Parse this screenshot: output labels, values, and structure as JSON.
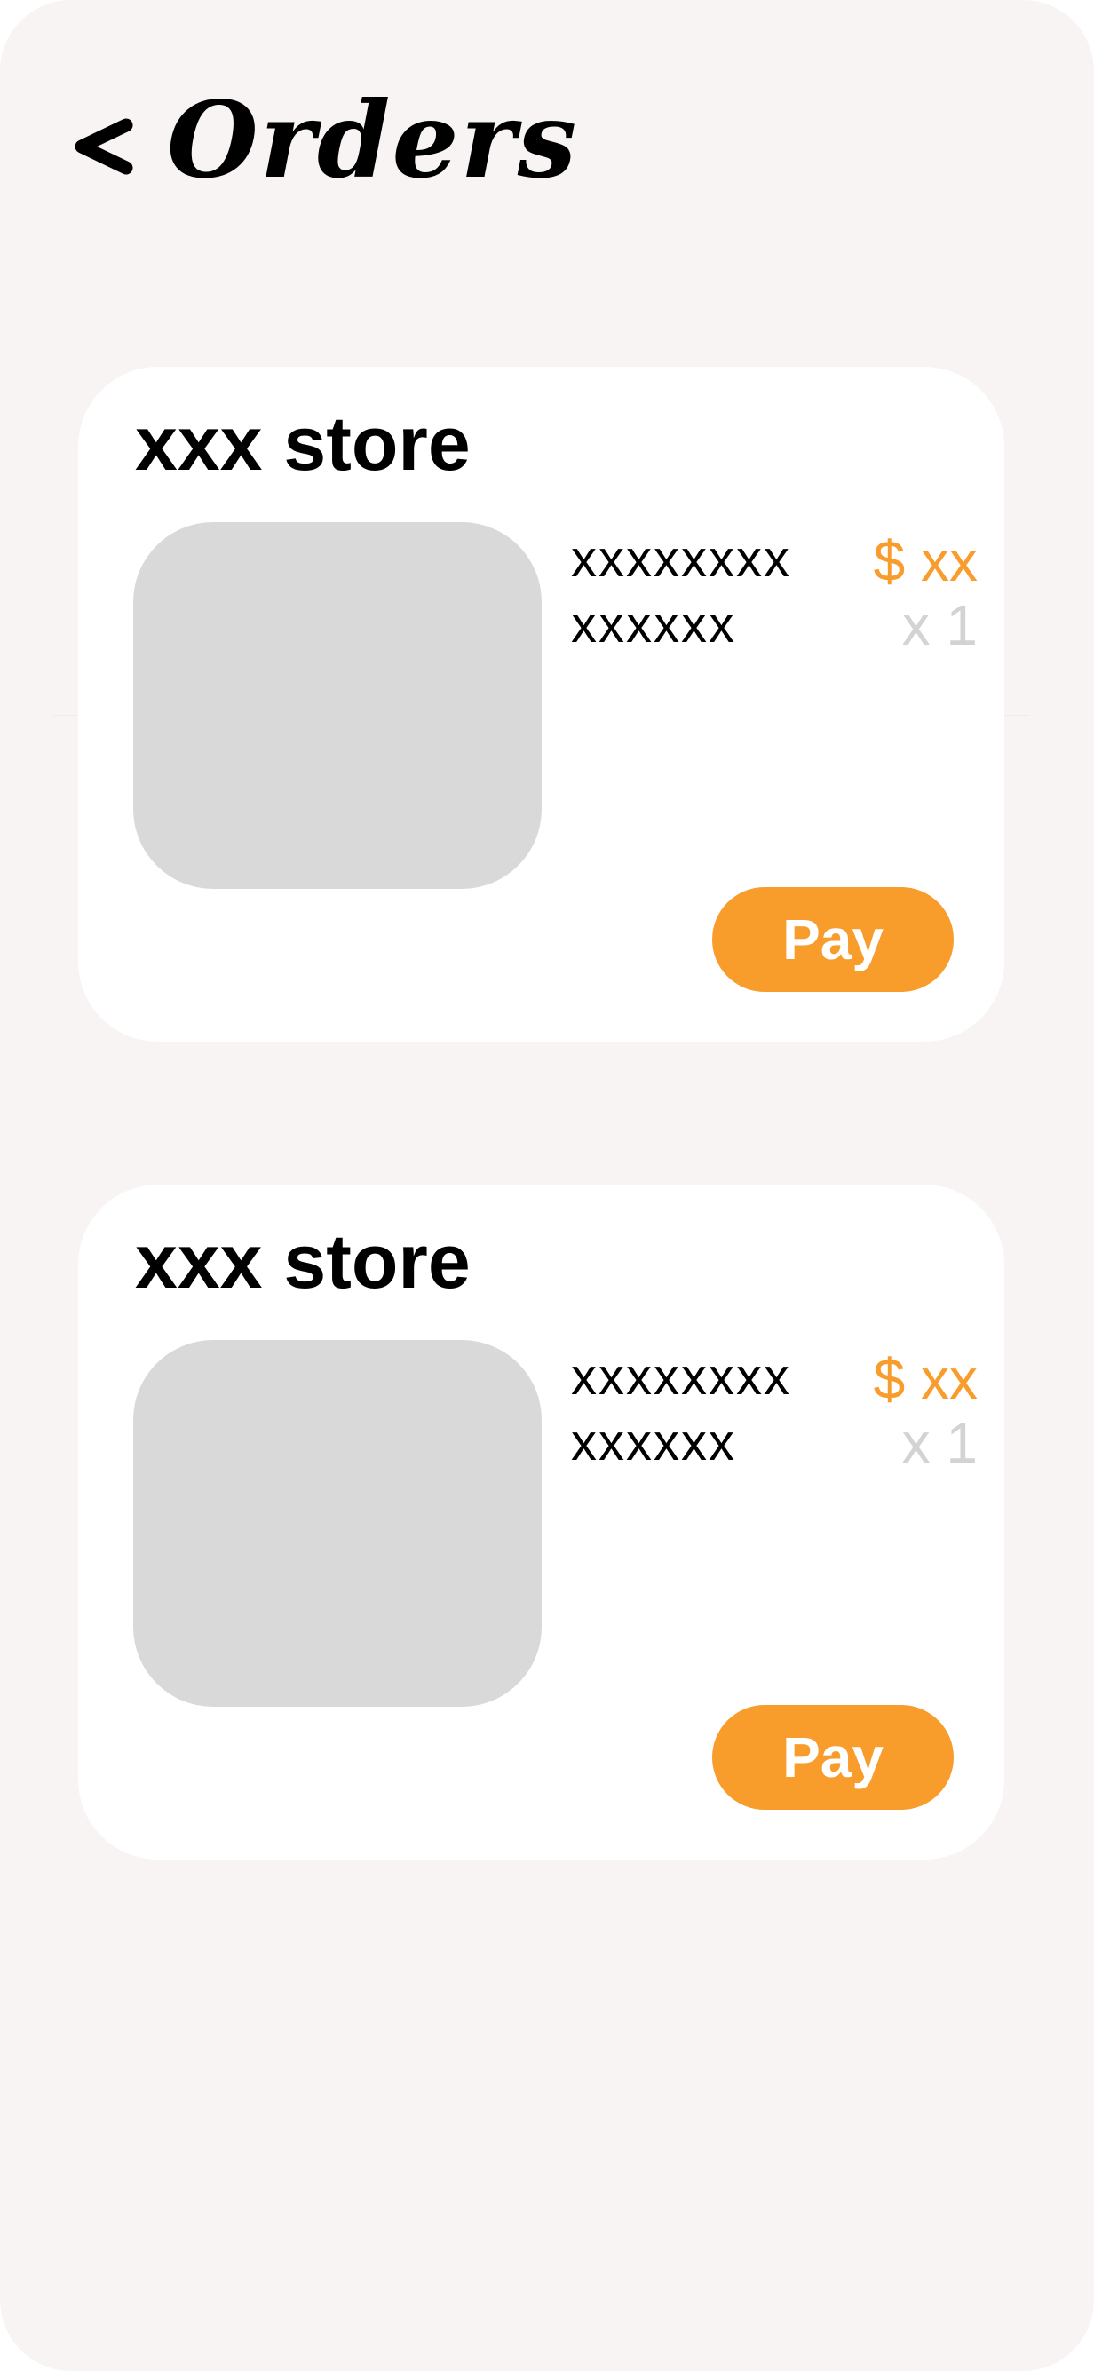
{
  "header": {
    "back_label": "<",
    "title": "Orders"
  },
  "orders": [
    {
      "store_name": "xxx store",
      "item_name": "xxxxxxxx",
      "item_variant": "xxxxxx",
      "price": "$ xx",
      "quantity": "x 1",
      "pay_label": "Pay"
    },
    {
      "store_name": "xxx store",
      "item_name": "xxxxxxxx",
      "item_variant": "xxxxxx",
      "price": "$ xx",
      "quantity": "x 1",
      "pay_label": "Pay"
    }
  ],
  "colors": {
    "background": "#f7f4f3",
    "card": "#ffffff",
    "accent": "#f89c2b",
    "placeholder": "#d9d9d9",
    "muted": "#d3d3d3"
  },
  "icons": {
    "back": "chevron-left-icon"
  }
}
